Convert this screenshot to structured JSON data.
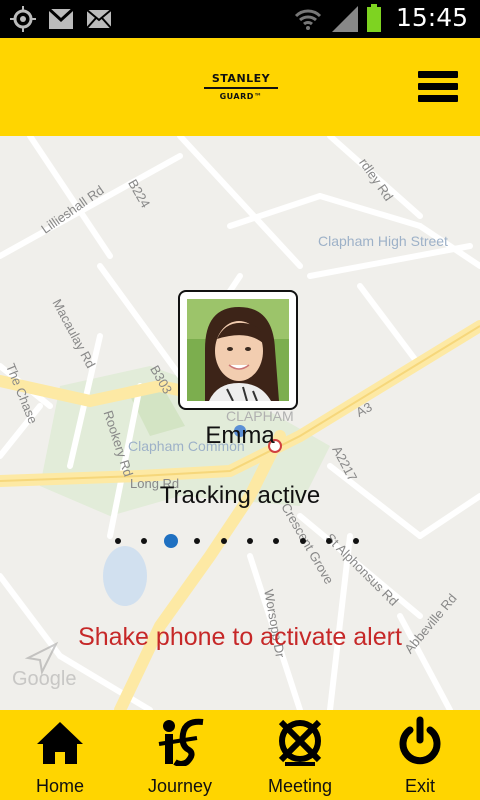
{
  "status_bar": {
    "time": "15:45",
    "icons": [
      "gps-icon",
      "gmail-icon",
      "email-icon",
      "wifi-icon",
      "signal-icon",
      "battery-icon"
    ]
  },
  "header": {
    "logo_line1": "STANLEY",
    "logo_line2": "GUARD™",
    "menu_icon": "hamburger-menu-icon"
  },
  "map": {
    "labels": {
      "lilleshall": "Lillieshall Rd",
      "b224": "B224",
      "clapham_high_street": "Clapham High Street",
      "macaulay": "Macaulay Rd",
      "the_chase": "The Chase",
      "b303": "B303",
      "clapham": "CLAPHAM",
      "a3": "A3",
      "clapham_common": "Clapham Common",
      "rookery": "Rookery Rd",
      "long_rd": "Long Rd",
      "a2217": "A2217",
      "crescent_grove": "Crescent Grove",
      "st_alphonsus": "St Alphonsus Rd",
      "abbeville": "Abbeville Rd",
      "worsopp": "Worsopp Dr",
      "north": "rdley Rd",
      "google": "Google"
    }
  },
  "tracking": {
    "name": "Emma",
    "status": "Tracking active",
    "dots_total": 10,
    "dots_active_index": 2
  },
  "alert_text": "Shake phone to activate alert",
  "colors": {
    "brand_yellow": "#ffd500",
    "alert_red": "#c62828",
    "dot_blue": "#1f70c1"
  },
  "nav": {
    "home": "Home",
    "journey": "Journey",
    "meeting": "Meeting",
    "exit": "Exit"
  }
}
